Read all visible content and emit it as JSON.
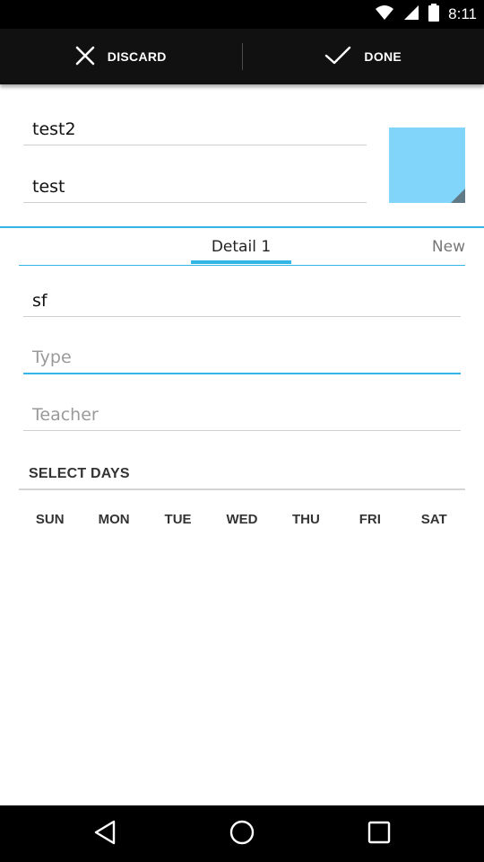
{
  "status_bar": {
    "time": "8:11",
    "icons": [
      "wifi-icon",
      "signal-icon",
      "battery-icon"
    ]
  },
  "action_bar": {
    "discard_label": "DISCARD",
    "done_label": "DONE"
  },
  "header": {
    "name_value": "test2",
    "subtitle_value": "test",
    "swatch_color": "#81d4fa"
  },
  "tabs": [
    {
      "label": "Detail 1",
      "selected": true
    },
    {
      "label": "New",
      "selected": false
    }
  ],
  "detail": {
    "subject_value": "sf",
    "type_placeholder": "Type",
    "teacher_placeholder": "Teacher"
  },
  "select_days": {
    "title": "SELECT DAYS",
    "days": [
      "SUN",
      "MON",
      "TUE",
      "WED",
      "THU",
      "FRI",
      "SAT"
    ]
  },
  "colors": {
    "accent": "#33b5e5",
    "action_bar_bg": "#111111"
  },
  "nav_bar": {
    "icons": [
      "back-icon",
      "home-icon",
      "recents-icon"
    ]
  }
}
